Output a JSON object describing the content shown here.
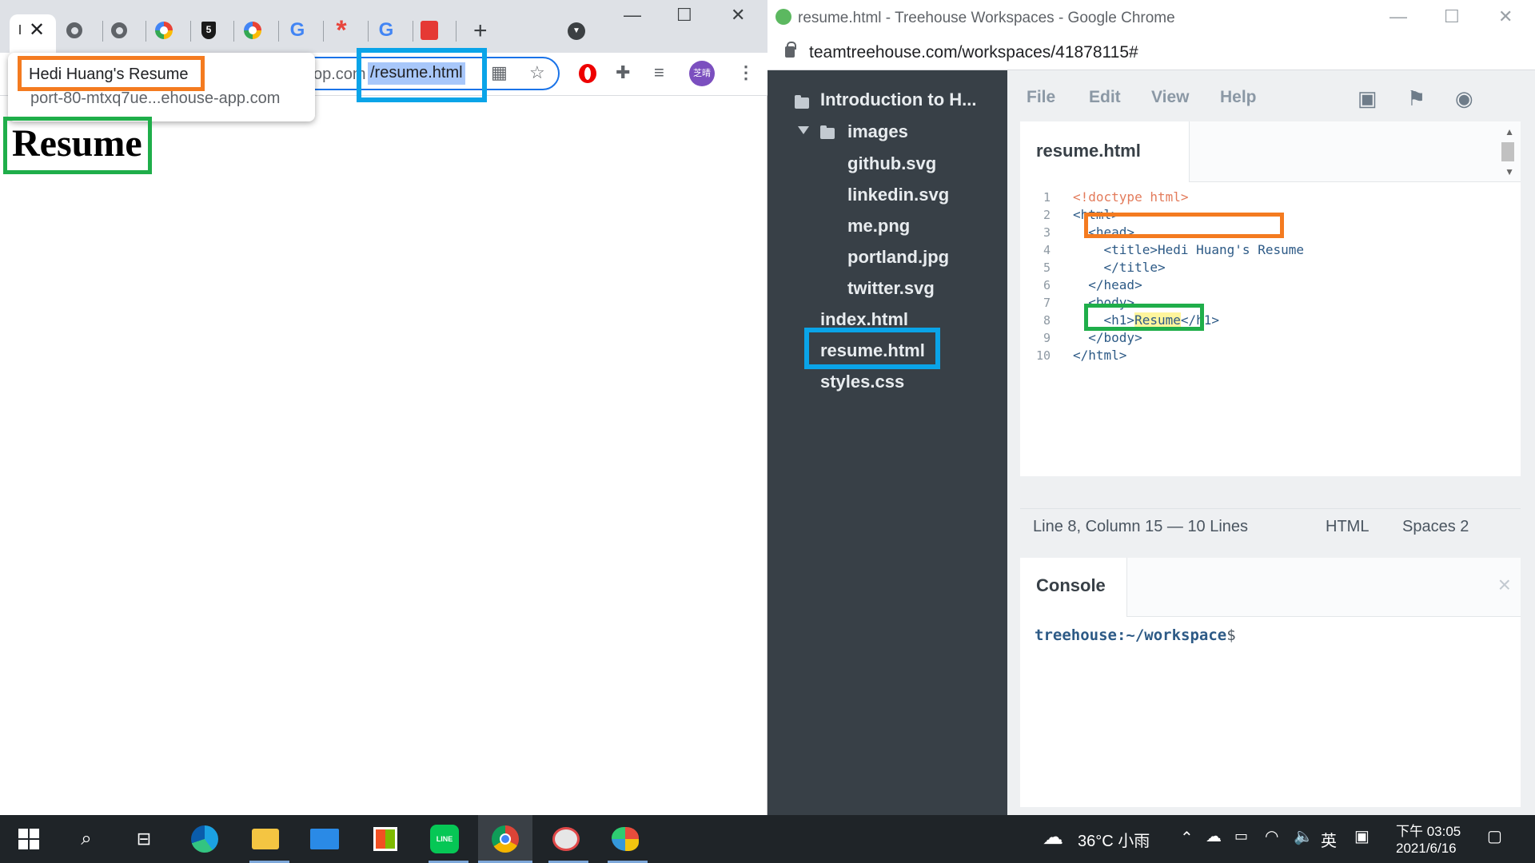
{
  "left_window": {
    "tooltip": {
      "title": "Hedi Huang's Resume",
      "url": "port-80-mtxq7ue...ehouse-app.com"
    },
    "address": {
      "prefix": "op.com",
      "highlighted": "/resume.html"
    },
    "avatar_text": "芝晴",
    "page": {
      "heading": "Resume"
    },
    "tab_icons": [
      "globe-icon",
      "globe-icon",
      "colorful-app-icon",
      "html5-shield-icon",
      "colorful-app-icon",
      "google-icon",
      "asterisk-icon",
      "google-icon",
      "red-app-icon"
    ]
  },
  "right_window": {
    "title": "resume.html - Treehouse Workspaces - Google Chrome",
    "address": "teamtreehouse.com/workspaces/41878115#",
    "file_tree": {
      "project": "Introduction to H...",
      "folder": "images",
      "images": [
        "github.svg",
        "linkedin.svg",
        "me.png",
        "portland.jpg",
        "twitter.svg"
      ],
      "files": [
        "index.html",
        "resume.html",
        "styles.css"
      ]
    },
    "menu": [
      "File",
      "Edit",
      "View",
      "Help"
    ],
    "editor_tab": "resume.html",
    "code_lines": [
      {
        "n": "1",
        "t": "<!doctype html>"
      },
      {
        "n": "2",
        "t": "<html>"
      },
      {
        "n": "3",
        "t": "  <head>"
      },
      {
        "n": "4",
        "t": "    <title>Hedi Huang's Resume"
      },
      {
        "n": "5",
        "t": "    </title>"
      },
      {
        "n": "6",
        "t": "  </head>"
      },
      {
        "n": "7",
        "t": "  <body>"
      },
      {
        "n": "8",
        "pre": "    <h1>",
        "word": "Resume",
        "post": "</h1>"
      },
      {
        "n": "9",
        "t": "  </body>"
      },
      {
        "n": "10",
        "t": "</html>"
      }
    ],
    "status": {
      "position": "Line 8, Column 15 — 10 Lines",
      "language": "HTML",
      "indent": "Spaces  2"
    },
    "console": {
      "label": "Console",
      "close": "×",
      "prompt_path": "treehouse:~/workspace",
      "prompt_symbol": "$"
    }
  },
  "taskbar": {
    "weather": "36°C  小雨",
    "ime": "英",
    "time": "下午 03:05",
    "date": "2021/6/16"
  },
  "colors": {
    "highlight_orange": "#f47b20",
    "highlight_blue": "#0aa4e8",
    "highlight_green": "#1fae4a",
    "sidebar_bg": "#384047",
    "accent": "#1a73e8"
  }
}
